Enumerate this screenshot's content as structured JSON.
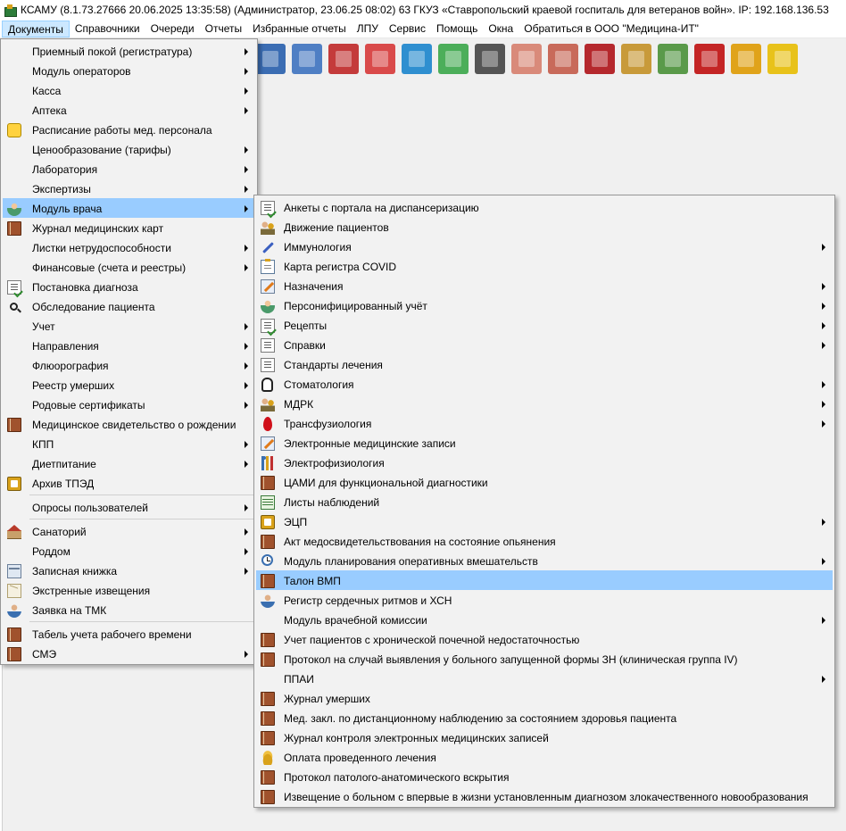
{
  "window": {
    "title": "КСАМУ (8.1.73.27666 20.06.2025 13:35:58) (Администратор, 23.06.25 08:02)  63 ГКУЗ «Ставропольский краевой госпиталь для ветеранов войн». IP: 192.168.136.53"
  },
  "menubar": {
    "items": [
      {
        "label": "Документы"
      },
      {
        "label": "Справочники"
      },
      {
        "label": "Очереди"
      },
      {
        "label": "Отчеты"
      },
      {
        "label": "Избранные отчеты"
      },
      {
        "label": "ЛПУ"
      },
      {
        "label": "Сервис"
      },
      {
        "label": "Помощь"
      },
      {
        "label": "Окна"
      },
      {
        "label": "Обратиться в ООО \"Медицина-ИТ\""
      }
    ]
  },
  "toolbar": {
    "buttons": [
      {
        "icon": "clock-document-icon",
        "color": "#3b6db3"
      },
      {
        "icon": "medical-record-icon",
        "color": "#4f7fc4"
      },
      {
        "icon": "medicine-bottle-icon",
        "color": "#c43b3b"
      },
      {
        "icon": "first-aid-card-icon",
        "color": "#d94a4a"
      },
      {
        "icon": "stacked-books-icon",
        "color": "#2f8fd0"
      },
      {
        "icon": "pills-icon",
        "color": "#4cae5a"
      },
      {
        "icon": "barcode-scanner-icon",
        "color": "#555555"
      },
      {
        "icon": "nurse-icon",
        "color": "#d98a7a"
      },
      {
        "icon": "thermometer-icon",
        "color": "#c86a5a"
      },
      {
        "icon": "red-book-icon",
        "color": "#b5282d"
      },
      {
        "icon": "calendar-icon",
        "color": "#c89a3a"
      },
      {
        "icon": "certificate-icon",
        "color": "#5a9a4a"
      },
      {
        "icon": "acrobat-icon",
        "color": "#c42525"
      },
      {
        "icon": "lock-icon",
        "color": "#e0a31a"
      },
      {
        "icon": "chat-bubble-icon",
        "color": "#e8c21a"
      }
    ]
  },
  "documents_menu": {
    "items": [
      {
        "label": "Приемный покой (регистратура)",
        "icon": "",
        "submenu": true
      },
      {
        "label": "Модуль операторов",
        "icon": "",
        "submenu": true
      },
      {
        "label": "Касса",
        "icon": "",
        "submenu": true
      },
      {
        "label": "Аптека",
        "icon": "",
        "submenu": true
      },
      {
        "label": "Расписание работы мед. персонала",
        "icon": "note-icon",
        "submenu": false
      },
      {
        "label": "Ценообразование (тарифы)",
        "icon": "",
        "submenu": true
      },
      {
        "label": "Лаборатория",
        "icon": "",
        "submenu": true
      },
      {
        "label": "Экспертизы",
        "icon": "",
        "submenu": true
      },
      {
        "label": "Модуль врача",
        "icon": "doctor-icon",
        "submenu": true,
        "highlighted": true
      },
      {
        "label": "Журнал медицинских карт",
        "icon": "book-icon",
        "submenu": false
      },
      {
        "label": "Листки нетрудоспособности",
        "icon": "",
        "submenu": true
      },
      {
        "label": "Финансовые (счета и реестры)",
        "icon": "",
        "submenu": true
      },
      {
        "label": "Постановка диагноза",
        "icon": "checklist-icon",
        "submenu": false
      },
      {
        "label": "Обследование пациента",
        "icon": "search-icon",
        "submenu": false
      },
      {
        "label": "Учет",
        "icon": "",
        "submenu": true
      },
      {
        "label": "Направления",
        "icon": "",
        "submenu": true
      },
      {
        "label": "Флюорография",
        "icon": "",
        "submenu": true
      },
      {
        "label": "Реестр умерших",
        "icon": "",
        "submenu": true
      },
      {
        "label": "Родовые сертификаты",
        "icon": "",
        "submenu": true
      },
      {
        "label": "Медицинское свидетельство о рождении",
        "icon": "book-icon",
        "submenu": false
      },
      {
        "label": "КПП",
        "icon": "",
        "submenu": true
      },
      {
        "label": "Диетпитание",
        "icon": "",
        "submenu": true
      },
      {
        "label": "Архив ТПЭД",
        "icon": "folder-icon",
        "submenu": false
      },
      {
        "separator": true
      },
      {
        "label": "Опросы пользователей",
        "icon": "",
        "submenu": true
      },
      {
        "separator": true
      },
      {
        "label": "Санаторий",
        "icon": "house-icon",
        "submenu": true
      },
      {
        "label": "Роддом",
        "icon": "",
        "submenu": true
      },
      {
        "label": "Записная книжка",
        "icon": "notebook-icon",
        "submenu": true
      },
      {
        "label": "Экстренные извещения",
        "icon": "mail-icon",
        "submenu": false
      },
      {
        "label": "Заявка на ТМК",
        "icon": "user-icon",
        "submenu": false
      },
      {
        "separator": true
      },
      {
        "label": "Табель учета рабочего времени",
        "icon": "book-icon",
        "submenu": false
      },
      {
        "label": "СМЭ",
        "icon": "book-icon",
        "submenu": true
      }
    ]
  },
  "doctor_submenu": {
    "items": [
      {
        "label": "Анкеты с портала на диспансеризацию",
        "icon": "checklist-icon",
        "submenu": false
      },
      {
        "label": "Движение пациентов",
        "icon": "users-icon",
        "submenu": false
      },
      {
        "label": "Иммунология",
        "icon": "syringe-icon",
        "submenu": true
      },
      {
        "label": "Карта регистра COVID",
        "icon": "clipboard-icon",
        "submenu": false
      },
      {
        "label": "Назначения",
        "icon": "pen-icon",
        "submenu": true
      },
      {
        "label": "Персонифицированный учёт",
        "icon": "doctor-icon",
        "submenu": true
      },
      {
        "label": "Рецепты",
        "icon": "checklist-icon",
        "submenu": true
      },
      {
        "label": "Справки",
        "icon": "list-icon",
        "submenu": true
      },
      {
        "label": "Стандарты лечения",
        "icon": "list-icon",
        "submenu": false
      },
      {
        "label": "Стоматология",
        "icon": "tooth-icon",
        "submenu": true
      },
      {
        "label": "МДРК",
        "icon": "users-icon",
        "submenu": true
      },
      {
        "label": "Трансфузиология",
        "icon": "blood-drop-icon",
        "submenu": true
      },
      {
        "label": "Электронные медицинские записи",
        "icon": "pen-icon",
        "submenu": false
      },
      {
        "label": "Электрофизиология",
        "icon": "chart-icon",
        "submenu": false
      },
      {
        "label": "ЦАМИ для функциональной диагностики",
        "icon": "book-icon",
        "submenu": false
      },
      {
        "label": "Листы наблюдений",
        "icon": "green-list-icon",
        "submenu": false
      },
      {
        "label": "ЭЦП",
        "icon": "folder-icon",
        "submenu": true
      },
      {
        "label": "Акт медосвидетельствования на состояние опьянения",
        "icon": "book-icon",
        "submenu": false
      },
      {
        "label": "Модуль планирования оперативных вмешательств",
        "icon": "clock-icon",
        "submenu": true
      },
      {
        "label": "Талон ВМП",
        "icon": "book-icon",
        "submenu": false,
        "highlighted": true
      },
      {
        "label": "Регистр сердечных ритмов и ХСН",
        "icon": "user-icon",
        "submenu": false
      },
      {
        "label": "Модуль врачебной комиссии",
        "icon": "",
        "submenu": true
      },
      {
        "label": "Учет пациентов с хронической почечной недостаточностью",
        "icon": "book-icon",
        "submenu": false
      },
      {
        "label": "Протокол на случай выявления у больного запущенной формы ЗН (клиническая группа IV)",
        "icon": "book-icon",
        "submenu": false
      },
      {
        "label": "ППАИ",
        "icon": "",
        "submenu": true
      },
      {
        "label": "Журнал умерших",
        "icon": "book-icon",
        "submenu": false
      },
      {
        "label": "Мед. закл. по дистанционному наблюдению за состоянием здоровья пациента",
        "icon": "book-icon",
        "submenu": false
      },
      {
        "label": "Журнал контроля электронных медицинских записей",
        "icon": "book-icon",
        "submenu": false
      },
      {
        "label": "Оплата проведенного лечения",
        "icon": "coins-icon",
        "submenu": false
      },
      {
        "label": "Протокол патолого-анатомического вскрытия",
        "icon": "book-icon",
        "submenu": false
      },
      {
        "label": "Извещение о больном с впервые в жизни установленным диагнозом злокачественного новообразования",
        "icon": "book-icon",
        "submenu": false
      }
    ]
  },
  "colors": {
    "menu_highlight": "#99ccff",
    "menubar_active": "#cce8ff",
    "menu_background": "#f2f2f2"
  }
}
